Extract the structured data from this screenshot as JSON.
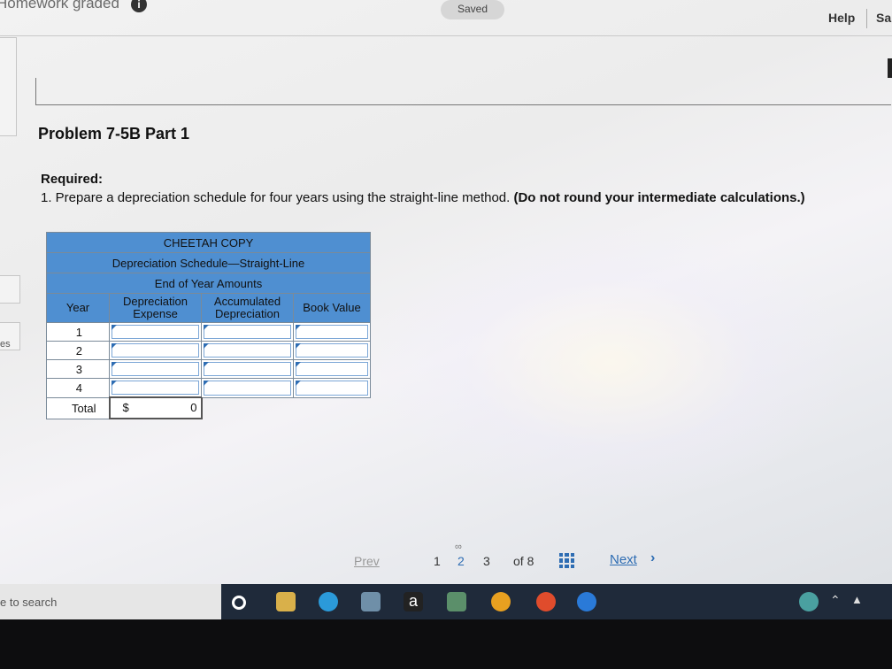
{
  "header": {
    "title": "Homework graded",
    "info_badge": "i",
    "saved": "Saved",
    "help": "Help",
    "save_exit": "Sa"
  },
  "problem": {
    "title": "Problem 7-5B Part 1",
    "required_label": "Required:",
    "instruction": "1. Prepare a depreciation schedule for four years using the straight-line method.",
    "instruction_bold": "(Do not round your intermediate calculations.)"
  },
  "table": {
    "company": "CHEETAH COPY",
    "schedule": "Depreciation Schedule—Straight-Line",
    "subtitle": "End of Year Amounts",
    "columns": [
      "Year",
      "Depreciation Expense",
      "Accumulated Depreciation",
      "Book Value"
    ],
    "years": [
      "1",
      "2",
      "3",
      "4"
    ],
    "total_label": "Total",
    "total_currency": "$",
    "total_value": "0"
  },
  "left": {
    "fragment": "es"
  },
  "pagination": {
    "prev": "Prev",
    "pages": [
      "1",
      "2",
      "3"
    ],
    "current": "2",
    "of": "of 8",
    "next": "Next"
  },
  "taskbar": {
    "search_placeholder": "e to search"
  },
  "colors": {
    "table_header": "#4f8fd1",
    "link": "#2e6db3"
  }
}
